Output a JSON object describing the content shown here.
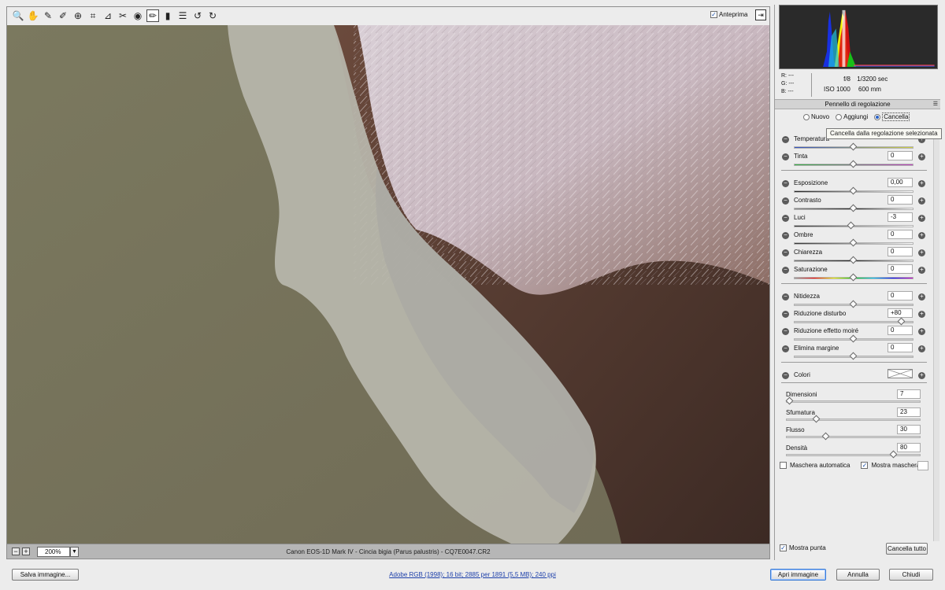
{
  "toolbar": {
    "tools": [
      {
        "name": "zoom-tool",
        "icon": "magnifier-icon",
        "glyph": "🔍"
      },
      {
        "name": "hand-tool",
        "icon": "hand-icon",
        "glyph": "✋"
      },
      {
        "name": "white-balance-tool",
        "icon": "eyedropper-icon",
        "glyph": "✎"
      },
      {
        "name": "color-sampler-tool",
        "icon": "color-sampler-icon",
        "glyph": "✐"
      },
      {
        "name": "targeted-adjustment-tool",
        "icon": "target-icon",
        "glyph": "⊕"
      },
      {
        "name": "crop-tool",
        "icon": "crop-icon",
        "glyph": "⌗"
      },
      {
        "name": "straighten-tool",
        "icon": "straighten-icon",
        "glyph": "⊿"
      },
      {
        "name": "spot-removal-tool",
        "icon": "spot-removal-icon",
        "glyph": "✂"
      },
      {
        "name": "red-eye-tool",
        "icon": "red-eye-icon",
        "glyph": "◉"
      },
      {
        "name": "adjustment-brush-tool",
        "icon": "brush-icon",
        "glyph": "✏",
        "active": true
      },
      {
        "name": "graduated-filter-tool",
        "icon": "graduated-filter-icon",
        "glyph": "▮"
      },
      {
        "name": "preferences-tool",
        "icon": "list-icon",
        "glyph": "☰"
      },
      {
        "name": "rotate-left-tool",
        "icon": "rotate-left-icon",
        "glyph": "↺"
      },
      {
        "name": "rotate-right-tool",
        "icon": "rotate-right-icon",
        "glyph": "↻"
      }
    ],
    "preview_label": "Anteprima",
    "preview_checked": true
  },
  "viewport": {
    "zoom": "200%",
    "caption": "Canon EOS-1D Mark IV  -  Cincia bigia (Parus palustris)  -  CQ7E0047.CR2"
  },
  "info": {
    "r": "R:  ---",
    "g": "G:  ---",
    "b": "B:  ---",
    "aperture": "f/8",
    "shutter": "1/3200 sec",
    "iso": "ISO 1000",
    "focal": "600 mm"
  },
  "panel": {
    "title": "Pennello di regolazione",
    "modes": [
      {
        "label": "Nuovo",
        "selected": false
      },
      {
        "label": "Aggiungi",
        "selected": false
      },
      {
        "label": "Cancella",
        "selected": true
      }
    ],
    "tooltip": "Cancella dalla regolazione selezionata",
    "adjustments_group1": [
      {
        "label": "Temperatura",
        "value": "",
        "knob": 0.5,
        "gradient": "linear-gradient(90deg,#3050c0,#d0d040)"
      },
      {
        "label": "Tinta",
        "value": "0",
        "knob": 0.5,
        "gradient": "linear-gradient(90deg,#30b040,#c040c0)"
      }
    ],
    "adjustments_group2": [
      {
        "label": "Esposizione",
        "value": "0,00",
        "knob": 0.5,
        "gradient": "linear-gradient(90deg,#222,#fff)"
      },
      {
        "label": "Contrasto",
        "value": "0",
        "knob": 0.5,
        "gradient": "linear-gradient(90deg,#888,#222 50%,#fff)"
      },
      {
        "label": "Luci",
        "value": "-3",
        "knob": 0.48,
        "gradient": "linear-gradient(90deg,#333,#fff)"
      },
      {
        "label": "Ombre",
        "value": "0",
        "knob": 0.5,
        "gradient": "linear-gradient(90deg,#333,#fff)"
      },
      {
        "label": "Chiarezza",
        "value": "0",
        "knob": 0.5,
        "gradient": "linear-gradient(90deg,#777,#222 50%,#eee)"
      },
      {
        "label": "Saturazione",
        "value": "0",
        "knob": 0.5,
        "gradient": "linear-gradient(90deg,#999,#f00,#ff0,#0c0,#0cf,#00f,#c0c)"
      }
    ],
    "adjustments_group3": [
      {
        "label": "Nitidezza",
        "value": "0",
        "knob": 0.5,
        "gradient": "linear-gradient(90deg,#ccc,#ccc)"
      },
      {
        "label": "Riduzione disturbo",
        "value": "+80",
        "knob": 0.9,
        "gradient": "linear-gradient(90deg,#ccc,#ccc)"
      },
      {
        "label": "Riduzione effetto moiré",
        "value": "0",
        "knob": 0.5,
        "gradient": "linear-gradient(90deg,#ccc,#ccc)"
      },
      {
        "label": "Elimina margine",
        "value": "0",
        "knob": 0.5,
        "gradient": "linear-gradient(90deg,#ccc,#ccc)"
      }
    ],
    "colors_label": "Colori",
    "brush": [
      {
        "label": "Dimensioni",
        "value": "7",
        "knob": 0.03
      },
      {
        "label": "Sfumatura",
        "value": "23",
        "knob": 0.23
      },
      {
        "label": "Flusso",
        "value": "30",
        "knob": 0.3
      },
      {
        "label": "Densità",
        "value": "80",
        "knob": 0.8
      }
    ],
    "auto_mask_label": "Maschera automatica",
    "auto_mask_checked": false,
    "show_mask_label": "Mostra maschera",
    "show_mask_checked": true,
    "show_pins_label": "Mostra punta",
    "show_pins_checked": true,
    "clear_all_label": "Cancella tutto"
  },
  "footer": {
    "save_label": "Salva immagine...",
    "workflow_link": "Adobe RGB (1998); 16 bit; 2885 per 1891 (5,5 MB); 240 ppi",
    "open_label": "Apri immagine",
    "cancel_label": "Annulla",
    "close_label": "Chiudi"
  }
}
